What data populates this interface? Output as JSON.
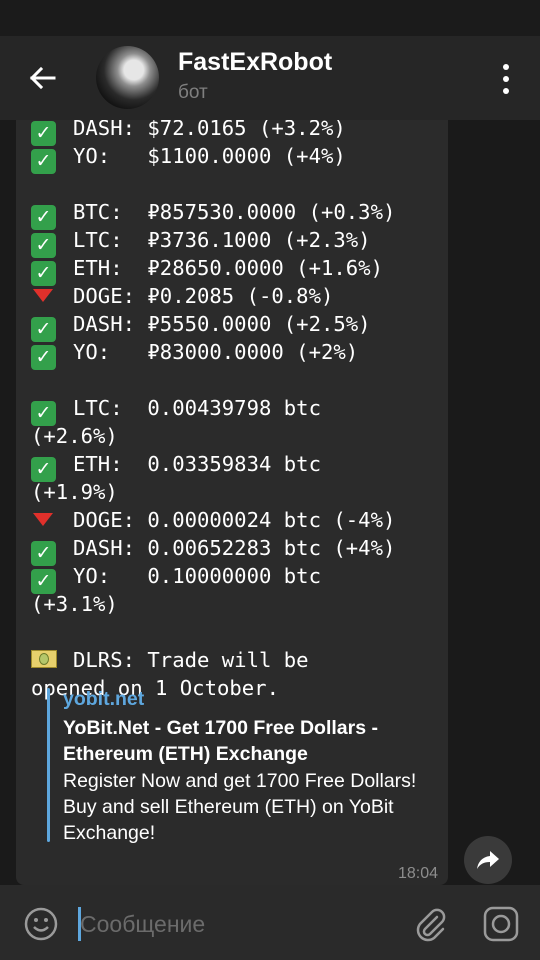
{
  "header": {
    "title": "FastExRobot",
    "subtitle": "бот"
  },
  "message": {
    "lines": [
      {
        "mark": "check",
        "text": "DASH: $72.0165 (+3.2%)"
      },
      {
        "mark": "check",
        "text": "YO:   $1100.0000 (+4%)"
      },
      {
        "mark": "none",
        "text": ""
      },
      {
        "mark": "check",
        "text": "BTC:  ₽857530.0000 (+0.3%)"
      },
      {
        "mark": "check",
        "text": "LTC:  ₽3736.1000 (+2.3%)"
      },
      {
        "mark": "check",
        "text": "ETH:  ₽28650.0000 (+1.6%)"
      },
      {
        "mark": "down",
        "text": "DOGE: ₽0.2085 (-0.8%)"
      },
      {
        "mark": "check",
        "text": "DASH: ₽5550.0000 (+2.5%)"
      },
      {
        "mark": "check",
        "text": "YO:   ₽83000.0000 (+2%)"
      },
      {
        "mark": "none",
        "text": ""
      },
      {
        "mark": "check",
        "text": "LTC:  0.00439798 btc"
      },
      {
        "mark": "none",
        "text": "(+2.6%)"
      },
      {
        "mark": "check",
        "text": "ETH:  0.03359834 btc"
      },
      {
        "mark": "none",
        "text": "(+1.9%)"
      },
      {
        "mark": "down",
        "text": "DOGE: 0.00000024 btc (-4%)"
      },
      {
        "mark": "check",
        "text": "DASH: 0.00652283 btc (+4%)"
      },
      {
        "mark": "check",
        "text": "YO:   0.10000000 btc"
      },
      {
        "mark": "none",
        "text": "(+3.1%)"
      },
      {
        "mark": "none",
        "text": ""
      },
      {
        "mark": "cash",
        "text": "DLRS: Trade will be"
      },
      {
        "mark": "none",
        "text": "opened on 1 October."
      }
    ],
    "link_preview": {
      "site": "yobit.net",
      "title": "YoBit.Net - Get 1700 Free Dollars - Ethereum (ETH) Exchange",
      "description": "Register Now and get 1700 Free Dollars! Buy and sell Ethereum (ETH) on YoBit Exchange!"
    },
    "time": "18:04"
  },
  "composer": {
    "placeholder": "Сообщение"
  },
  "icons": {
    "back": "back-arrow-icon",
    "menu": "more-vertical-icon",
    "share": "share-icon",
    "emoji": "emoji-icon",
    "attach": "paperclip-icon",
    "camera": "camera-icon",
    "check": "check-mark-icon",
    "down": "red-down-triangle-icon",
    "cash": "dollar-banknote-icon"
  },
  "colors": {
    "accent": "#5ea7de",
    "check": "#33a04b",
    "down": "#e0302b"
  }
}
